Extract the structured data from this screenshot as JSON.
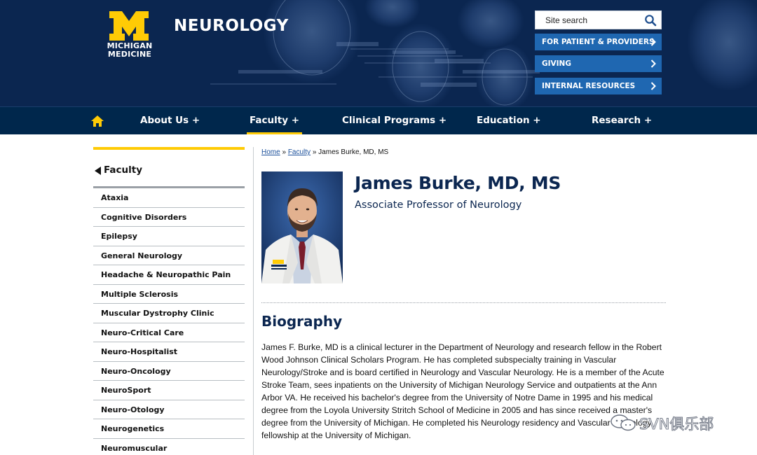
{
  "brand": {
    "logo_line1": "MICHIGAN",
    "logo_line2": "MEDICINE",
    "site_title": "NEUROLOGY",
    "maize": "#ffcb05",
    "navy": "#00274c",
    "link_blue": "#1f67b1"
  },
  "search": {
    "placeholder": "Site search",
    "icon": "search-icon"
  },
  "quick_links": [
    {
      "label": "FOR PATIENT & PROVIDERS"
    },
    {
      "label": "GIVING"
    },
    {
      "label": "INTERNAL RESOURCES"
    }
  ],
  "nav": {
    "home_icon": "home-icon",
    "items": [
      {
        "label": "About Us +"
      },
      {
        "label": "Faculty +",
        "active": true
      },
      {
        "label": "Clinical Programs +"
      },
      {
        "label": "Education +"
      },
      {
        "label": "Research +"
      }
    ]
  },
  "sidebar": {
    "heading": "Faculty",
    "items": [
      {
        "label": "Ataxia"
      },
      {
        "label": "Cognitive Disorders"
      },
      {
        "label": "Epilepsy"
      },
      {
        "label": "General Neurology"
      },
      {
        "label": "Headache & Neuropathic Pain"
      },
      {
        "label": "Multiple Sclerosis"
      },
      {
        "label": "Muscular Dystrophy Clinic"
      },
      {
        "label": "Neuro-Critical Care"
      },
      {
        "label": "Neuro-Hospitalist"
      },
      {
        "label": "Neuro-Oncology"
      },
      {
        "label": "NeuroSport"
      },
      {
        "label": "Neuro-Otology"
      },
      {
        "label": "Neurogenetics"
      },
      {
        "label": "Neuromuscular"
      }
    ]
  },
  "breadcrumb": {
    "home": "Home",
    "separator": " » ",
    "faculty": "Faculty",
    "current": "James Burke, MD, MS"
  },
  "profile": {
    "name": "James Burke, MD, MS",
    "title": "Associate Professor of Neurology"
  },
  "biography": {
    "heading": "Biography",
    "text": "James F. Burke, MD is a clinical lecturer in the Department of Neurology and research fellow in the Robert Wood Johnson Clinical Scholars Program. He has completed subspecialty training in Vascular Neurology/Stroke and is board certified in Neurology and Vascular Neurology. He is a member of the Acute Stroke Team, sees inpatients on the University of Michigan Neurology Service and outpatients at the Ann Arbor VA. He received his bachelor's degree from the University of Notre Dame in 1995 and his medical degree from the Loyola University Stritch School of Medicine in 2005 and has since received a master's degree from the University of Michigan. He completed his Neurology residency and Vascular Neurology fellowship at the University of Michigan."
  },
  "watermark": {
    "text": "SVN俱乐部"
  }
}
